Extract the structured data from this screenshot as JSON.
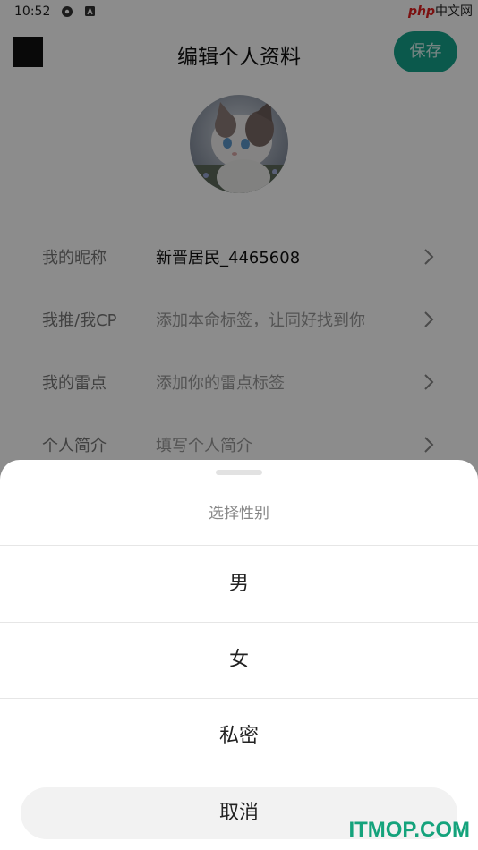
{
  "status_bar": {
    "time": "10:52",
    "icons": [
      "settings-icon",
      "a-icon"
    ],
    "watermark": {
      "brand": "php",
      "suffix": "中文网"
    }
  },
  "header": {
    "title": "编辑个人资料",
    "save_label": "保存",
    "back_icon": "back-icon"
  },
  "avatar": {
    "description": "cat-avatar"
  },
  "profile_rows": [
    {
      "label": "我的昵称",
      "value": "新晋居民_4465608",
      "is_placeholder": false
    },
    {
      "label": "我推/我CP",
      "value": "添加本命标签，让同好找到你",
      "is_placeholder": true
    },
    {
      "label": "我的雷点",
      "value": "添加你的雷点标签",
      "is_placeholder": true
    },
    {
      "label": "个人简介",
      "value": "填写个人简介",
      "is_placeholder": true
    }
  ],
  "gender_sheet": {
    "title": "选择性别",
    "options": [
      "男",
      "女",
      "私密"
    ],
    "cancel_label": "取消"
  },
  "site_watermark": "ITMOP.COM",
  "colors": {
    "accent": "#14a38b",
    "mask": "rgba(0,0,0,0.45)"
  }
}
